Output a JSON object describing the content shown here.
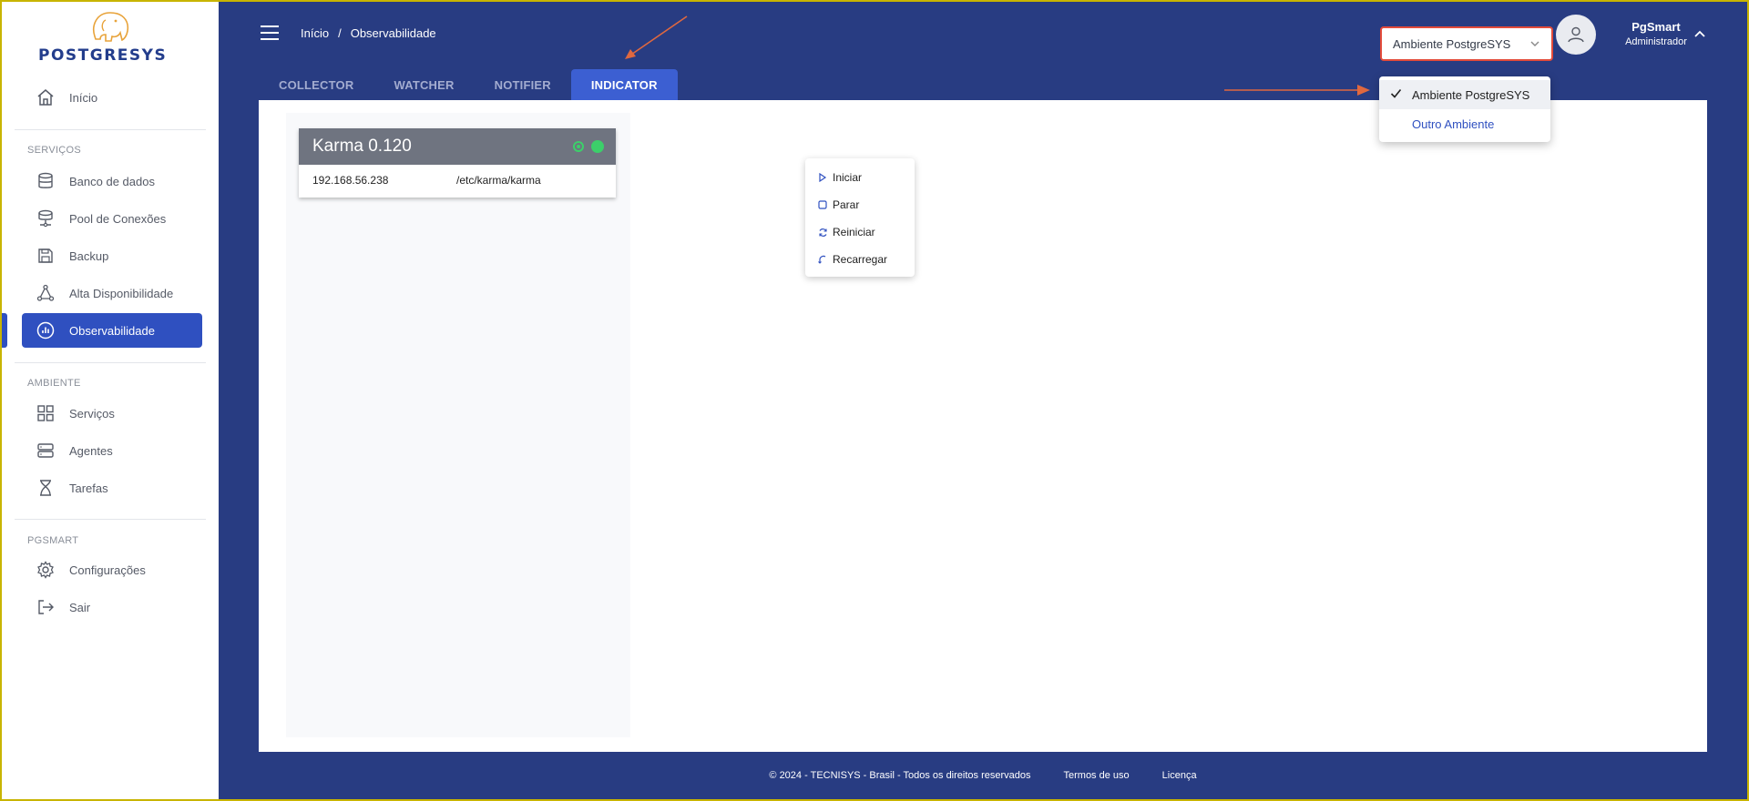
{
  "brand": {
    "logo_text": "POSTGRESYS"
  },
  "sidebar": {
    "home": "Início",
    "sections": [
      {
        "label": "SERVIÇOS",
        "items": [
          "Banco de dados",
          "Pool de Conexões",
          "Backup",
          "Alta Disponibilidade",
          "Observabilidade"
        ]
      },
      {
        "label": "AMBIENTE",
        "items": [
          "Serviços",
          "Agentes",
          "Tarefas"
        ]
      },
      {
        "label": "PGSMART",
        "items": [
          "Configurações",
          "Sair"
        ]
      }
    ],
    "active_item": "Observabilidade"
  },
  "header": {
    "breadcrumb": [
      "Início",
      "Observabilidade"
    ],
    "environment_select": "Ambiente PostgreSYS",
    "user": {
      "name": "PgSmart",
      "role": "Administrador"
    }
  },
  "tabs": [
    "COLLECTOR",
    "WATCHER",
    "NOTIFIER",
    "INDICATOR"
  ],
  "active_tab": "INDICATOR",
  "card": {
    "title": "Karma 0.120",
    "ip": "192.168.56.238",
    "path": "/etc/karma/karma"
  },
  "context_menu": [
    "Iniciar",
    "Parar",
    "Reiniciar",
    "Recarregar"
  ],
  "environment_dropdown": {
    "options": [
      "Ambiente PostgreSYS",
      "Outro Ambiente"
    ],
    "selected": "Ambiente PostgreSYS"
  },
  "footer": {
    "copyright": "© 2024 - TECNISYS - Brasil - Todos os direitos reservados",
    "terms": "Termos de uso",
    "license": "Licença"
  },
  "colors": {
    "header_bg": "#283c82",
    "accent": "#2f50c0",
    "status_green": "#3ccf6a",
    "highlight_red": "#e34b3a"
  }
}
